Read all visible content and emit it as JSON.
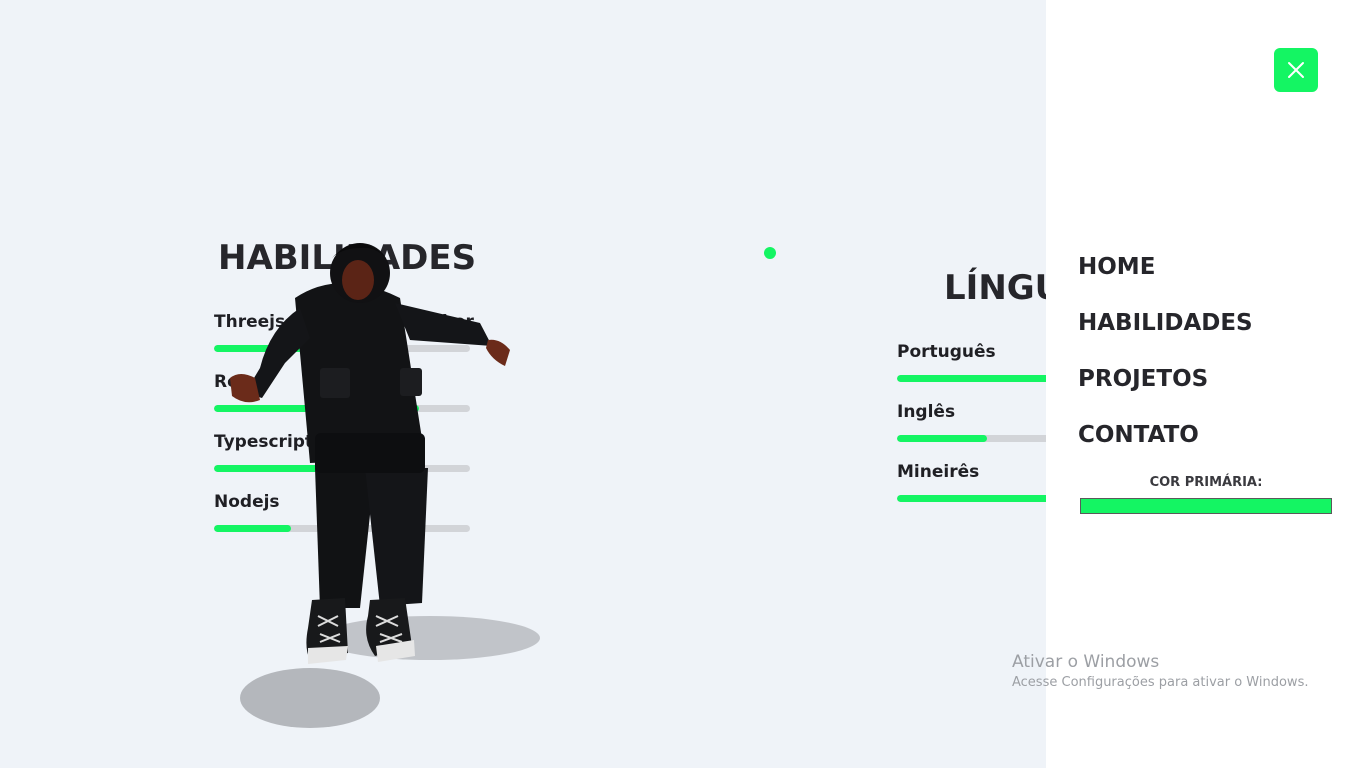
{
  "skills": {
    "title": "HABILIDADES",
    "items": [
      {
        "label": "Threejs / React Three Fiber",
        "level": 0.75
      },
      {
        "label": "React",
        "level": 0.8
      },
      {
        "label": "Typescript",
        "level": 0.6
      },
      {
        "label": "Nodejs",
        "level": 0.3
      }
    ]
  },
  "languages": {
    "title": "LÍNGUAS",
    "items": [
      {
        "label": "Português",
        "level": 1.0
      },
      {
        "label": "Inglês",
        "level": 0.35
      },
      {
        "label": "Mineirês",
        "level": 1.0
      }
    ]
  },
  "menu": {
    "close_icon": "close-icon",
    "items": [
      "HOME",
      "HABILIDADES",
      "PROJETOS",
      "CONTATO"
    ],
    "color_label": "COR PRIMÁRIA:",
    "primary_color": "#14f563"
  },
  "watermark": {
    "title": "Ativar o Windows",
    "subtitle": "Acesse Configurações para ativar o Windows."
  }
}
